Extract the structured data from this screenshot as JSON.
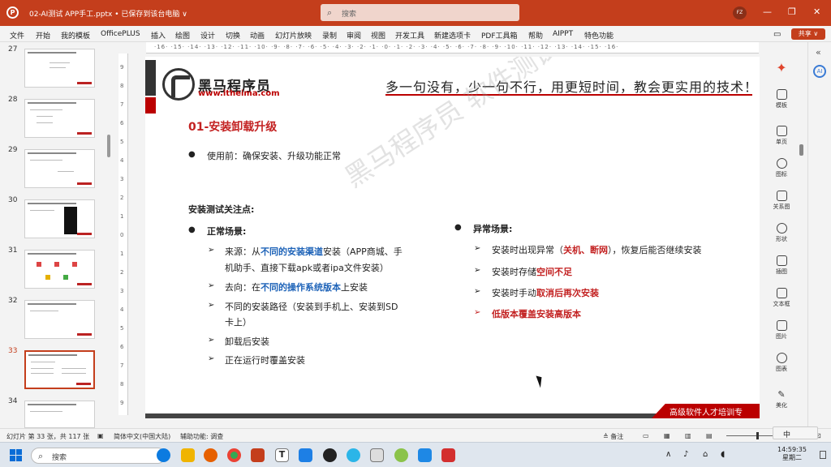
{
  "titlebar": {
    "app_icon": "P",
    "doc_title": "02-AI测试 APP手工.pptx • 已保存到该台电脑 ∨",
    "search_placeholder": "搜索",
    "user_initials": "FZ",
    "minimize": "—",
    "restore": "❐",
    "close": "✕"
  },
  "menu": {
    "items": [
      "文件",
      "开始",
      "我的模板",
      "OfficePLUS",
      "插入",
      "绘图",
      "设计",
      "切换",
      "动画",
      "幻灯片放映",
      "录制",
      "审阅",
      "视图",
      "开发工具",
      "新建选项卡",
      "PDF工具箱",
      "帮助",
      "AIPPT",
      "特色功能"
    ],
    "share_label": "共享 ∨"
  },
  "thumbnails": [
    {
      "num": "27"
    },
    {
      "num": "28"
    },
    {
      "num": "29"
    },
    {
      "num": "30"
    },
    {
      "num": "31"
    },
    {
      "num": "32"
    },
    {
      "num": "33",
      "selected": true
    },
    {
      "num": "34"
    }
  ],
  "ruler": {
    "top_ticks": "·16· ·15· ·14· ·13· ·12· ·11· ·10· ·9· ·8· ·7· ·6· ·5· ·4· ·3· ·2· ·1· ·0· ·1· ·2· ·3· ·4· ·5· ·6· ·7· ·8· ·9· ·10· ·11· ·12· ·13· ·14· ·15· ·16·",
    "left_ticks": "9 8 7 6 5 4 3 2 1 0 1 2 3 4 5 6 7 8 9"
  },
  "slide": {
    "brand_name": "黑马程序员",
    "brand_url": "www.itheima.com",
    "slogan": "多一句没有，少一句不行，用更短时间，教会更实用的技术！",
    "title": "01-安装卸载升级",
    "intro": "使用前：确保安装、升级功能正常",
    "section_heading": "安装测试关注点:",
    "normal_heading": "正常场景:",
    "normal_items": [
      {
        "pre": "来源：从",
        "hl": "不同的安装渠道",
        "post": "安装（APP商城、手",
        "line2": "机助手、直接下载apk或者ipa文件安装）"
      },
      {
        "pre": "去向：在",
        "hl": "不同的操作系统版本",
        "post": "上安装",
        "line2": ""
      },
      {
        "pre": "不同的安装路径（安装到手机上、安装到SD",
        "hl": "",
        "post": "",
        "line2": "卡上）"
      },
      {
        "pre": "卸载后安装",
        "hl": "",
        "post": "",
        "line2": ""
      },
      {
        "pre": "正在运行时覆盖安装",
        "hl": "",
        "post": "",
        "line2": ""
      }
    ],
    "abnormal_heading": "异常场景:",
    "abnormal_items": [
      {
        "pre": "安装时出现异常（",
        "hl": "关机、断网",
        "post": "），恢复后能否继续安装"
      },
      {
        "pre": "安装时存储",
        "hl": "空间不足",
        "post": ""
      },
      {
        "pre": "安装时手动",
        "hl": "取消后再次安装",
        "post": ""
      },
      {
        "pre": "",
        "hl": "低版本覆盖安装高版本",
        "post": ""
      }
    ],
    "watermark": "黑马程序员 软件测试",
    "footer_text": "高级软件人才培训专"
  },
  "right_panel": {
    "items": [
      "模板",
      "单页",
      "图标",
      "关系图",
      "形状",
      "插图",
      "文本框",
      "图片",
      "图表",
      "美化"
    ]
  },
  "statusbar": {
    "slide_count": "幻灯片 第 33 张，共 117 张",
    "language": "简体中文(中国大陆)",
    "accessibility": "辅助功能: 调查",
    "notes": "备注"
  },
  "taskbar": {
    "search_placeholder": "搜索",
    "time": "14:59:35",
    "date": "星期二",
    "ime": "中"
  },
  "colors": {
    "accent": "#c43e1c",
    "title_red": "#c32222",
    "highlight_blue": "#1e63b8"
  }
}
